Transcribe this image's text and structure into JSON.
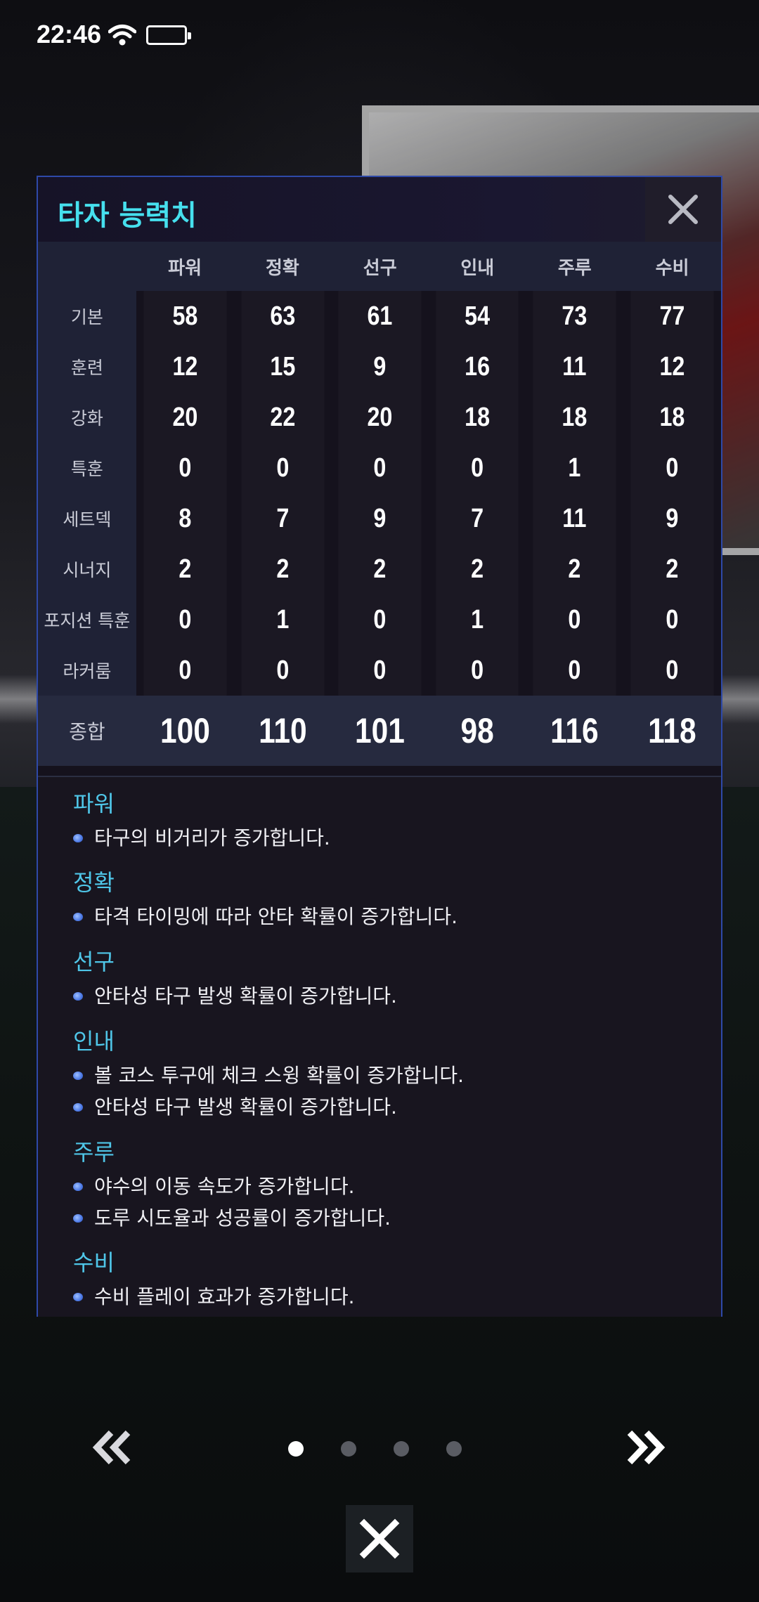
{
  "status_bar": {
    "time": "22:46"
  },
  "panel": {
    "title": "타자 능력치",
    "columns": [
      "파워",
      "정확",
      "선구",
      "인내",
      "주루",
      "수비"
    ],
    "rows": [
      {
        "label": "기본",
        "values": [
          "58",
          "63",
          "61",
          "54",
          "73",
          "77"
        ]
      },
      {
        "label": "훈련",
        "values": [
          "12",
          "15",
          "9",
          "16",
          "11",
          "12"
        ]
      },
      {
        "label": "강화",
        "values": [
          "20",
          "22",
          "20",
          "18",
          "18",
          "18"
        ]
      },
      {
        "label": "특훈",
        "values": [
          "0",
          "0",
          "0",
          "0",
          "1",
          "0"
        ]
      },
      {
        "label": "세트덱",
        "values": [
          "8",
          "7",
          "9",
          "7",
          "11",
          "9"
        ]
      },
      {
        "label": "시너지",
        "values": [
          "2",
          "2",
          "2",
          "2",
          "2",
          "2"
        ]
      },
      {
        "label": "포지션 특훈",
        "values": [
          "0",
          "1",
          "0",
          "1",
          "0",
          "0"
        ]
      },
      {
        "label": "라커룸",
        "values": [
          "0",
          "0",
          "0",
          "0",
          "0",
          "0"
        ]
      }
    ],
    "total": {
      "label": "종합",
      "values": [
        "100",
        "110",
        "101",
        "98",
        "116",
        "118"
      ]
    },
    "descriptions": [
      {
        "title": "파워",
        "lines": [
          "타구의 비거리가 증가합니다."
        ]
      },
      {
        "title": "정확",
        "lines": [
          "타격 타이밍에 따라 안타 확률이 증가합니다."
        ]
      },
      {
        "title": "선구",
        "lines": [
          "안타성 타구 발생 확률이 증가합니다."
        ]
      },
      {
        "title": "인내",
        "lines": [
          "볼 코스 투구에 체크 스윙 확률이 증가합니다.",
          "안타성 타구 발생 확률이 증가합니다."
        ]
      },
      {
        "title": "주루",
        "lines": [
          "야수의 이동 속도가 증가합니다.",
          "도루 시도율과 성공률이 증가합니다."
        ]
      },
      {
        "title": "수비",
        "lines": [
          "수비 플레이 효과가 증가합니다."
        ]
      }
    ]
  },
  "pagination": {
    "total_pages": 4,
    "current_page": 1
  },
  "colors": {
    "title_accent": "#46e0ee",
    "desc_title": "#4fc6e8",
    "panel_border": "#2e49a8"
  }
}
